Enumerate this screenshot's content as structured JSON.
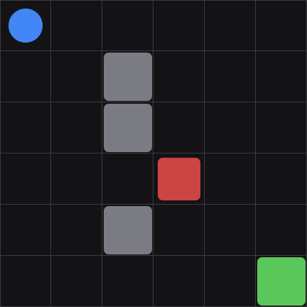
{
  "board": {
    "rows": 6,
    "cols": 6,
    "background": "#131316",
    "grid_color": "#3a3a40"
  },
  "pieces": [
    {
      "kind": "player",
      "name": "player-token",
      "row": 0,
      "col": 0,
      "color": "#4287f5",
      "shape": "circle"
    },
    {
      "kind": "wall",
      "name": "wall-block",
      "row": 1,
      "col": 2,
      "color": "#7b7b84",
      "shape": "rounded-square"
    },
    {
      "kind": "wall",
      "name": "wall-block",
      "row": 2,
      "col": 2,
      "color": "#7b7b84",
      "shape": "rounded-square"
    },
    {
      "kind": "enemy",
      "name": "enemy-block",
      "row": 3,
      "col": 3,
      "color": "#cc4444",
      "shape": "rounded-square"
    },
    {
      "kind": "wall",
      "name": "wall-block",
      "row": 4,
      "col": 2,
      "color": "#7b7b84",
      "shape": "rounded-square"
    },
    {
      "kind": "goal",
      "name": "goal-tile",
      "row": 5,
      "col": 5,
      "color": "#5ac85a",
      "shape": "rounded-square"
    }
  ]
}
